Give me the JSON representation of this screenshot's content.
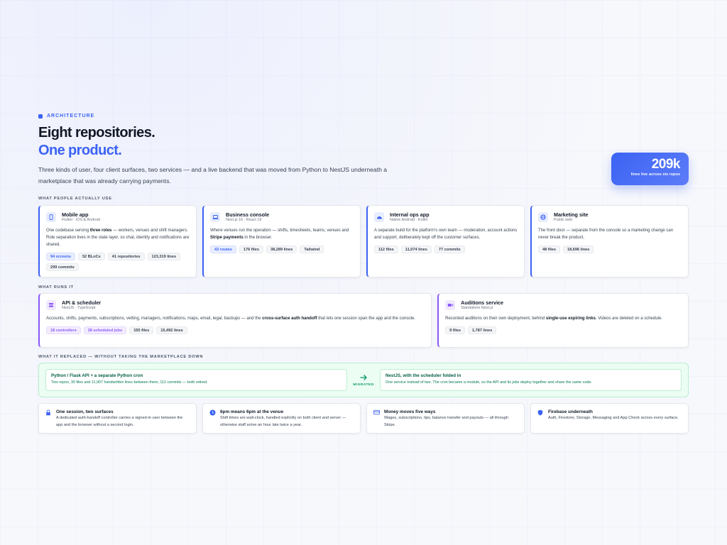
{
  "header": {
    "eyebrow": "ARCHITECTURE",
    "title_line1": "Eight repositories.",
    "title_line2": "One product.",
    "lead": "Three kinds of user, four client surfaces, two services — and a live backend that was moved from Python to NestJS underneath a marketplace that was already carrying payments."
  },
  "stat": {
    "value": "209k",
    "caption": "lines live across six repos"
  },
  "sections": {
    "clients": "WHAT PEOPLE ACTUALLY USE",
    "services": "WHAT RUNS IT",
    "migration": "WHAT IT REPLACED — WITHOUT TAKING THE MARKETPLACE DOWN"
  },
  "clients": [
    {
      "icon": "phone-icon",
      "title": "Mobile app",
      "sub": "Flutter · iOS & Android",
      "desc": [
        [
          "One codebase serving ",
          false
        ],
        [
          "three roles",
          true
        ],
        [
          " — workers, venues and shift managers. Role separation lives in the state layer, so chat, identity and notifications are shared.",
          false
        ]
      ],
      "pills": [
        [
          "94 screens",
          "blue"
        ],
        [
          "52 BLoCs",
          ""
        ],
        [
          "41 repositories",
          ""
        ],
        [
          "123,319 lines",
          ""
        ],
        [
          "299 commits",
          ""
        ]
      ]
    },
    {
      "icon": "laptop-icon",
      "title": "Business console",
      "sub": "Next.js 16 · React 19",
      "desc": [
        [
          "Where venues run the operation — shifts, timesheets, teams, venues and ",
          false
        ],
        [
          "Stripe payments",
          true
        ],
        [
          " in the browser.",
          false
        ]
      ],
      "pills": [
        [
          "43 routes",
          "blue"
        ],
        [
          "176 files",
          ""
        ],
        [
          "38,289 lines",
          ""
        ],
        [
          "Tailwind",
          ""
        ]
      ]
    },
    {
      "icon": "android-icon",
      "title": "Internal ops app",
      "sub": "Native Android · Kotlin",
      "desc": [
        [
          "A separate build for the platform's own team — moderation, account actions and support, deliberately kept off the customer surfaces.",
          false
        ]
      ],
      "pills": [
        [
          "112 files",
          ""
        ],
        [
          "11,074 lines",
          ""
        ],
        [
          "77 commits",
          ""
        ]
      ]
    },
    {
      "icon": "globe-icon",
      "title": "Marketing site",
      "sub": "Public web",
      "desc": [
        [
          "The front door — separate from the console so a marketing change can never break the product.",
          false
        ]
      ],
      "pills": [
        [
          "48 files",
          ""
        ],
        [
          "18,696 lines",
          ""
        ]
      ]
    }
  ],
  "services": [
    {
      "icon": "server-icon",
      "title": "API & scheduler",
      "sub": "NestJS · TypeScript",
      "desc": [
        [
          "Accounts, shifts, payments, subscriptions, vetting, managers, notifications, maps, email, legal, backups — and the ",
          false
        ],
        [
          "cross-surface auth handoff",
          true
        ],
        [
          " that lets one session span the app and the console.",
          false
        ]
      ],
      "pills": [
        [
          "18 controllers",
          "purple"
        ],
        [
          "28 scheduled jobs",
          "purple"
        ],
        [
          "155 files",
          ""
        ],
        [
          "15,492 lines",
          ""
        ]
      ]
    },
    {
      "icon": "video-icon",
      "title": "Auditions service",
      "sub": "Standalone Next.js",
      "desc": [
        [
          "Recorded auditions on their own deployment, behind ",
          false
        ],
        [
          "single-use expiring links",
          true
        ],
        [
          ". Videos are deleted on a schedule.",
          false
        ]
      ],
      "pills": [
        [
          "9 files",
          ""
        ],
        [
          "1,787 lines",
          ""
        ]
      ]
    }
  ],
  "migration": {
    "from_title": "Python / Flask API + a separate Python cron",
    "from_desc": "Two repos, 30 files and 11,907 handwritten lines between them, 112 commits — both retired.",
    "arrow_label": "MIGRATED",
    "to_title": "NestJS, with the scheduler folded in",
    "to_desc": "One service instead of two. The cron became a module, so the API and its jobs deploy together and share the same code."
  },
  "features": [
    {
      "icon": "lock-icon",
      "title": "One session, two surfaces",
      "desc": "A dedicated auth-handoff controller carries a signed-in user between the app and the browser without a second login."
    },
    {
      "icon": "clock-icon",
      "title": "6pm means 6pm at the venue",
      "desc": "Shift times are wall-clock, handled explicitly on both client and server — otherwise staff arrive an hour late twice a year."
    },
    {
      "icon": "card-icon",
      "title": "Money moves five ways",
      "desc": "Wages, subscriptions, tips, balance transfer and payouts — all through Stripe."
    },
    {
      "icon": "shield-icon",
      "title": "Firebase underneath",
      "desc": "Auth, Firestore, Storage, Messaging and App Check across every surface."
    }
  ],
  "colors": {
    "accent": "#3b63f3",
    "purple": "#8b5cf6",
    "green": "#059669"
  }
}
